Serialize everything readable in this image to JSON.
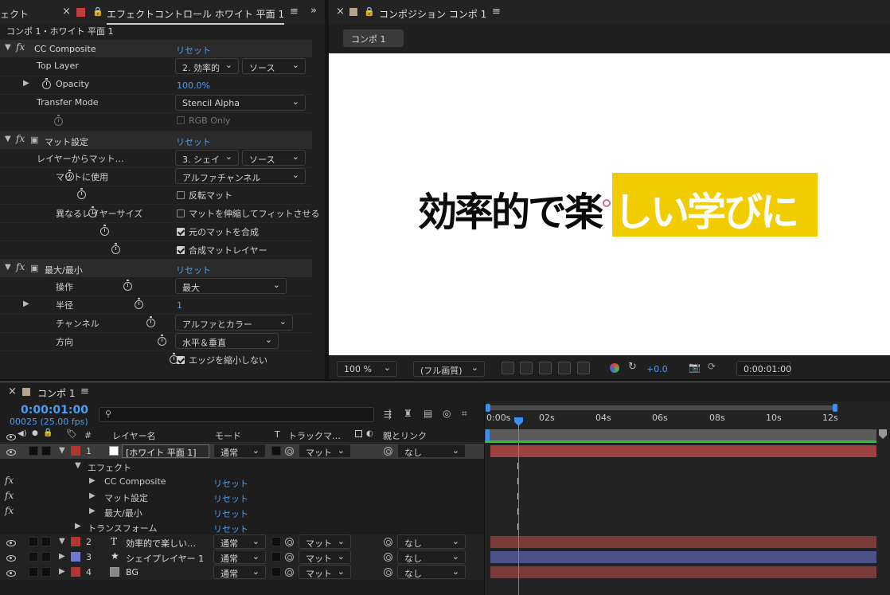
{
  "effects_panel": {
    "tab_partial": "ェクト",
    "tab_title": "エフェクトコントロール ホワイト 平面 1",
    "breadcrumb": "コンポ 1・ホワイト 平面 1",
    "effects": [
      {
        "name": "CC Composite",
        "reset": "リセット",
        "props": [
          {
            "label": "Top Layer",
            "dd1": "2. 効率的",
            "dd2": "ソース"
          },
          {
            "label": "Opacity",
            "value": "100.0%"
          },
          {
            "label": "Transfer Mode",
            "dd": "Stencil Alpha"
          },
          {
            "check": "RGB Only",
            "checked": false
          }
        ]
      },
      {
        "name": "マット設定",
        "reset": "リセット",
        "props": [
          {
            "label": "レイヤーからマット…",
            "dd1": "3. シェイ",
            "dd2": "ソース"
          },
          {
            "label": "マットに使用",
            "dd": "アルファチャンネル"
          },
          {
            "check": "反転マット",
            "checked": false
          },
          {
            "label": "異なるレイヤーサイズ",
            "check": "マットを伸縮してフィットさせる",
            "checked": false
          },
          {
            "check": "元のマットを合成",
            "checked": true
          },
          {
            "check": "合成マットレイヤー",
            "checked": true
          }
        ]
      },
      {
        "name": "最大/最小",
        "reset": "リセット",
        "props": [
          {
            "label": "操作",
            "dd": "最大"
          },
          {
            "label": "半径",
            "value": "1"
          },
          {
            "label": "チャンネル",
            "dd": "アルファとカラー"
          },
          {
            "label": "方向",
            "dd": "水平＆垂直"
          },
          {
            "check": "エッジを縮小しない",
            "checked": true
          }
        ]
      }
    ]
  },
  "comp_panel": {
    "tab_title": "コンポジション コンポ 1",
    "comp_chip": "コンポ 1",
    "canvas_text_black": "効率的で楽",
    "canvas_text_white": "しい学びに",
    "highlight_color": "#f0cc00",
    "footer": {
      "zoom": "100 %",
      "quality": "(フル画質)",
      "exposure": "+0.0",
      "timecode": "0:00:01:00"
    }
  },
  "timeline": {
    "tab_title": "コンポ 1",
    "current_time": "0:00:01:00",
    "frame_info": "00025 (25.00 fps)",
    "search_placeholder": "",
    "columns": {
      "layer_name": "レイヤー名",
      "mode": "モード",
      "t": "T",
      "track_matte": "トラックマ…",
      "parent": "親とリンク"
    },
    "ruler": [
      "0:00s",
      "02s",
      "04s",
      "06s",
      "08s",
      "10s",
      "12s"
    ],
    "layers": [
      {
        "num": "1",
        "name": "[ホワイト 平面 1]",
        "mode": "通常",
        "matte": "マット",
        "parent": "なし",
        "color": "#b43434",
        "bar_color": "#9c4040"
      },
      {
        "num": "2",
        "name": "効率的で楽しい…",
        "mode": "通常",
        "matte": "マット",
        "parent": "なし",
        "color": "#b43434",
        "bar_color": "#7a3a3a",
        "type_icon": "T"
      },
      {
        "num": "3",
        "name": "シェイプレイヤー 1",
        "mode": "通常",
        "matte": "マット",
        "parent": "なし",
        "color": "#6a7ad8",
        "bar_color": "#4a5288",
        "type_icon": "★"
      },
      {
        "num": "4",
        "name": "BG",
        "mode": "通常",
        "matte": "マット",
        "parent": "なし",
        "color": "#b43434",
        "bar_color": "#7a3a3a"
      }
    ],
    "sub_rows": {
      "effects_group": "エフェクト",
      "effects": [
        "CC Composite",
        "マット設定",
        "最大/最小"
      ],
      "transform": "トランスフォーム",
      "reset": "リセット"
    }
  }
}
